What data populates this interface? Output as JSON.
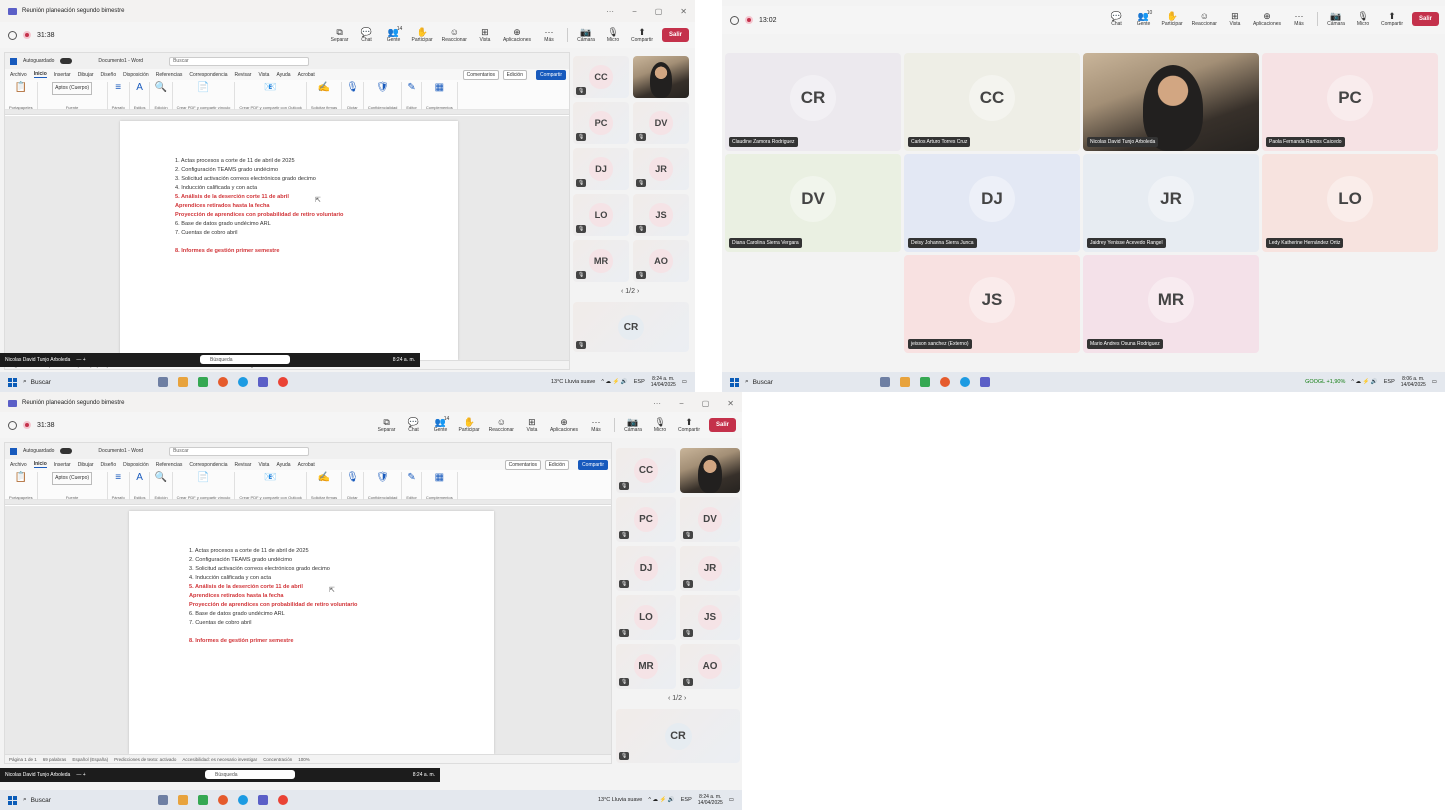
{
  "window": {
    "title": "Reunión planeación segundo bimestre",
    "controls": [
      "···",
      "−",
      "▢",
      "✕"
    ]
  },
  "meeting": {
    "timer_main": "31:38",
    "timer_grid": "13:02",
    "tools": [
      {
        "label": "Separar",
        "icon": "⧉"
      },
      {
        "label": "Chat",
        "icon": "💬"
      },
      {
        "label": "Gente",
        "icon": "👥",
        "count": "14"
      },
      {
        "label": "Participar",
        "icon": "✋"
      },
      {
        "label": "Reaccionar",
        "icon": "☺"
      },
      {
        "label": "Vista",
        "icon": "⊞"
      },
      {
        "label": "Aplicaciones",
        "icon": "⊕"
      },
      {
        "label": "Más",
        "icon": "···"
      }
    ],
    "tools_grid": [
      {
        "label": "Chat",
        "icon": "💬"
      },
      {
        "label": "Gente",
        "icon": "👥",
        "count": "10"
      },
      {
        "label": "Participar",
        "icon": "✋"
      },
      {
        "label": "Reaccionar",
        "icon": "☺"
      },
      {
        "label": "Vista",
        "icon": "⊞"
      },
      {
        "label": "Aplicaciones",
        "icon": "⊕"
      },
      {
        "label": "Más",
        "icon": "···"
      }
    ],
    "devices": [
      {
        "label": "Cámara",
        "icon": "📷"
      },
      {
        "label": "Micro",
        "icon": "🎙"
      },
      {
        "label": "Compartir",
        "icon": "⬆"
      }
    ],
    "leave": "Salir",
    "page_indicator": "1/2",
    "presenter": "Nicolas David Tunjo Arboleda"
  },
  "word": {
    "autosave": "Autoguardado",
    "doc": "Documento1 - Word",
    "search": "Buscar",
    "tabs": [
      "Archivo",
      "Inicio",
      "Insertar",
      "Dibujar",
      "Diseño",
      "Disposición",
      "Referencias",
      "Correspondencia",
      "Revisar",
      "Vista",
      "Ayuda",
      "Acrobat"
    ],
    "comments": "Comentarios",
    "editing": "Edición",
    "share": "Compartir",
    "groups": [
      {
        "big": "📋",
        "label": "Portapapeles"
      },
      {
        "big": "Aptos (Cuerpo)",
        "label": "Fuente"
      },
      {
        "big": "≡",
        "label": "Párrafo"
      },
      {
        "big": "A",
        "label": "Estilos"
      },
      {
        "big": "🔍",
        "label": "Edición"
      },
      {
        "big": "📄",
        "label": "Crear PDF y compartir vínculo"
      },
      {
        "big": "📧",
        "label": "Crear PDF y compartir con Outlook"
      },
      {
        "big": "✍",
        "label": "Solicitar firmas"
      },
      {
        "big": "🎙",
        "label": "Dictar"
      },
      {
        "big": "🛡",
        "label": "Confidencialidad"
      },
      {
        "big": "✎",
        "label": "Editor"
      },
      {
        "big": "▦",
        "label": "Complementos"
      }
    ],
    "font_size": "12",
    "items": [
      {
        "text": "1.  Actas procesos a corte de 11 de abril de 2025",
        "red": false
      },
      {
        "text": "2.  Configuración TEAMS grado undécimo",
        "red": false
      },
      {
        "text": "3.  Solicitud activación correos electrónicos grado decimo",
        "red": false
      },
      {
        "text": "4.  Inducción calificada y con acta",
        "red": false
      },
      {
        "text": "5.  Análisis de la deserción corte 11 de abril",
        "red": true
      },
      {
        "text": "     Aprendices retirados hasta la fecha",
        "red": true
      },
      {
        "text": "     Proyección de aprendices con probabilidad de retiro voluntario",
        "red": true
      },
      {
        "text": "6.  Base de datos grado undécimo ARL",
        "red": false
      },
      {
        "text": "7.  Cuentas de cobro abril",
        "red": false
      },
      {
        "text": "",
        "red": false
      },
      {
        "text": "8.  Informes de gestión primer semestre",
        "red": true
      }
    ],
    "status": [
      "Página 1 de 1",
      "69 palabras",
      "Español (España)",
      "Predicciones de texto: activado",
      "Accesibilidad: es necesario investigar",
      "Concentración",
      "100%"
    ]
  },
  "sharing": {
    "name": "Nicolas David Tunjo Arboleda",
    "search": "Búsqueda",
    "time": "8:24 a. m.",
    "lang": "ESP"
  },
  "taskbar": {
    "search": "Buscar",
    "weather": "13°C  Lluvia suave",
    "stock": "GOOGL  +1,90%",
    "lang": "ESP",
    "time1": "8:24 a. m.",
    "date1": "14/04/2025",
    "time2": "8:06 a. m.",
    "date2": "14/04/2025"
  },
  "side_tiles": [
    "CC",
    "PC",
    "DV",
    "DJ",
    "JR",
    "LO",
    "JS",
    "MR",
    "AO"
  ],
  "side_bottom": "CR",
  "grid": [
    {
      "ini": "CR",
      "name": "Claudine Zamora Rodriguez",
      "color": "#ece9ee"
    },
    {
      "ini": "CC",
      "name": "Carlos Arturo Torres Cruz",
      "color": "#eeeee6"
    },
    {
      "ini": "",
      "name": "Nicolas David Tunjo Arboleda",
      "video": true
    },
    {
      "ini": "PC",
      "name": "Paola Fernanda Ramos Caicedo",
      "color": "#f6e2e4"
    },
    {
      "ini": "DV",
      "name": "Diana Carolina Sierra Vergara",
      "color": "#eaf0e2"
    },
    {
      "ini": "DJ",
      "name": "Deisy Johanna Sierra Junca",
      "color": "#e3e8f4"
    },
    {
      "ini": "JR",
      "name": "Jaidrey Yenisse Acevedo Rangel",
      "color": "#e7ecf2"
    },
    {
      "ini": "LO",
      "name": "Ledy Katherine Hernández Ortiz",
      "color": "#f7e3df"
    },
    {
      "ini": "JS",
      "name": "jeisson sanchez (Externo)",
      "color": "#f8e1e1"
    },
    {
      "ini": "MR",
      "name": "Mario Andres Osuna Rodriguez",
      "color": "#f4e1e9"
    }
  ],
  "colors": {
    "teams": "#5b5fc7",
    "leave": "#c4314b",
    "word_blue": "#185abd",
    "red_text": "#d13438"
  }
}
